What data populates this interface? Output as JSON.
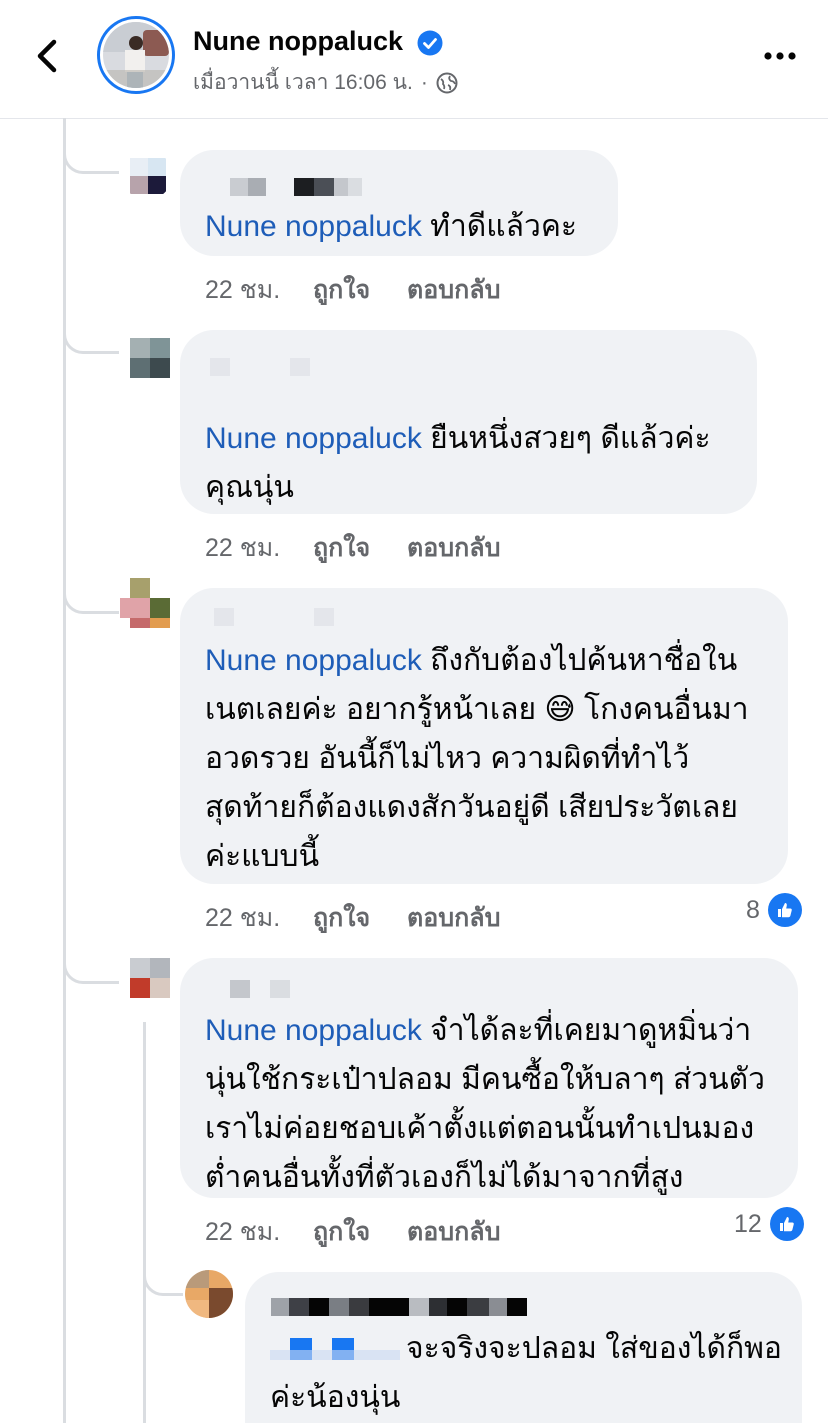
{
  "header": {
    "page_name": "Nune noppaluck",
    "post_time": "เมื่อวานนี้ เวลา 16:06 น.",
    "separator": "·"
  },
  "colors": {
    "accent": "#1877f2",
    "mention": "#1e5db8",
    "bubble": "#f0f2f5",
    "muted": "#65676b"
  },
  "icons": [
    "back-chevron-icon",
    "verified-badge-icon",
    "globe-icon",
    "more-options-icon",
    "like-thumb-icon"
  ],
  "comments": [
    {
      "mention": "Nune noppaluck",
      "lines": [
        "ทำดีแล้วคะ"
      ],
      "time": "22 ชม.",
      "like_label": "ถูกใจ",
      "reply_label": "ตอบกลับ"
    },
    {
      "mention": "Nune noppaluck",
      "lines": [
        "ยืนหนึ่งสวยๆ ดีแล้วค่ะ",
        "คุณนุ่น"
      ],
      "time": "22 ชม.",
      "like_label": "ถูกใจ",
      "reply_label": "ตอบกลับ"
    },
    {
      "mention": "Nune noppaluck",
      "lines": [
        "ถึงกับต้องไปค้นหาชื่อใน",
        "เนตเลยค่ะ อยากรู้หน้าเลย 😅 โกงคนอื่นมา",
        "อวดรวย อันนี้ก็ไม่ไหว ความผิดที่ทำไว้",
        "สุดท้ายก็ต้องแดงสักวันอยู่ดี เสียประวัตเลย",
        "ค่ะแบบนี้"
      ],
      "time": "22 ชม.",
      "like_label": "ถูกใจ",
      "reply_label": "ตอบกลับ",
      "reaction_count": "8"
    },
    {
      "mention": "Nune noppaluck",
      "lines": [
        "จำได้ละที่เคยมาดูหมิ่นว่า",
        "นุ่นใช้กระเป๋าปลอม มีคนซื้อให้บลาๆ ส่วนตัว",
        "เราไม่ค่อยชอบเค้าตั้งแต่ตอนนั้นทำเปนมอง",
        "ต่ำคนอื่นทั้งที่ตัวเองก็ไม่ได้มาจากที่สูง"
      ],
      "time": "22 ชม.",
      "like_label": "ถูกใจ",
      "reply_label": "ตอบกลับ",
      "reaction_count": "12"
    },
    {
      "lines": [
        "จะจริงจะปลอม ใส่ของได้ก็พอ",
        "ค่ะน้องนุ่น"
      ]
    }
  ]
}
